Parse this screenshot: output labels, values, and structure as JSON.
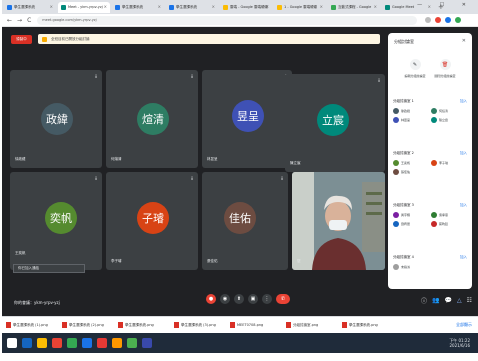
{
  "browser": {
    "tabs": [
      {
        "label": "學生選課系統",
        "color": "#1a73e8",
        "active": false
      },
      {
        "label": "Meet - ykm-yrpv-yzj",
        "color": "#00897b",
        "active": true
      },
      {
        "label": "學生選課系統",
        "color": "#1a73e8",
        "active": false
      },
      {
        "label": "學生選課系統",
        "color": "#1a73e8",
        "active": false
      },
      {
        "label": "雲端 - Google 雲端硬碟",
        "color": "#fbbc04",
        "active": false
      },
      {
        "label": "1 - Google 雲端硬碟",
        "color": "#fbbc04",
        "active": false
      },
      {
        "label": "互動式課程 - Google",
        "color": "#34a853",
        "active": false
      },
      {
        "label": "Google Meet",
        "color": "#00897b",
        "active": false
      }
    ],
    "new_tab": "+",
    "window_controls": "— ☐ ✕",
    "url": "meet.google.com/ykm-yrpv-yzj",
    "back": "←",
    "forward": "→",
    "reload": "C"
  },
  "meet": {
    "rec_label": "錄製中",
    "notice": "全班目前已開放分組討論",
    "tiles": [
      {
        "name": "政緯",
        "label": "徐政緯",
        "color": "#455a64"
      },
      {
        "name": "煊清",
        "label": "何煊清",
        "color": "#2e7d63"
      },
      {
        "name": "昱呈",
        "label": "林昱呈",
        "color": "#3f51b5"
      },
      {
        "name": "立宸",
        "label": "陳立宸",
        "color": "#00897b"
      },
      {
        "name": "奕帆",
        "label": "王奕帆",
        "color": "#558b2f"
      },
      {
        "name": "子璿",
        "label": "李子璿",
        "color": "#d84315"
      },
      {
        "name": "佳佑",
        "label": "張佳佑",
        "color": "#6d4c41"
      },
      {
        "name": "",
        "label": "您",
        "color": ""
      }
    ],
    "caption": "你已加入通話",
    "meeting_code": "你的會議：ykm-yrpv-yzj",
    "controls": [
      "●",
      "◉",
      "⬆",
      "▣",
      "⋮",
      "✆"
    ],
    "right_icons": [
      "ⓘ",
      "👥",
      "💬",
      "△",
      "☷"
    ]
  },
  "panel": {
    "title": "分組討論室",
    "close": "✕",
    "actions": [
      {
        "icon": "✎",
        "label": "編輯分組討論室"
      },
      {
        "icon": "🗑",
        "label": "關閉分組討論室"
      }
    ],
    "groups": [
      {
        "title": "分組討論室 1",
        "link": "加入",
        "members": [
          {
            "n": "徐政緯",
            "c": "#455a64"
          },
          {
            "n": "何煊清",
            "c": "#2e7d63"
          },
          {
            "n": "林昱呈",
            "c": "#3f51b5"
          },
          {
            "n": "陳立宸",
            "c": "#00897b"
          }
        ]
      },
      {
        "title": "分組討論室 2",
        "link": "加入",
        "members": [
          {
            "n": "王奕帆",
            "c": "#558b2f"
          },
          {
            "n": "李子璿",
            "c": "#d84315"
          },
          {
            "n": "張佳佑",
            "c": "#6d4c41"
          }
        ]
      },
      {
        "title": "分組討論室 3",
        "link": "加入",
        "members": [
          {
            "n": "黃宇翔",
            "c": "#7b1fa2"
          },
          {
            "n": "吳承恩",
            "c": "#2e7d32"
          },
          {
            "n": "劉宥辰",
            "c": "#1565c0"
          },
          {
            "n": "蔡昀廷",
            "c": "#c62828"
          }
        ]
      },
      {
        "title": "分組討論室 4",
        "link": "加入",
        "members": [
          {
            "n": "未指派",
            "c": "#9e9e9e"
          }
        ]
      }
    ]
  },
  "downloads": {
    "items": [
      "學生選課系統 (1).png",
      "學生選課系統 (2).png",
      "學生選課系統.png",
      "學生選課系統 (3).png",
      "MEET0708.png",
      "分組討論室.png",
      "學生選課系統.png"
    ],
    "show_all": "全部顯示"
  },
  "taskbar": {
    "apps": [
      "#ffffff",
      "#1565c0",
      "#fbbc04",
      "#ea4335",
      "#34a853",
      "#1a73e8",
      "#e53935",
      "#ff9800",
      "#4caf50",
      "#3949ab"
    ],
    "time": "下午 01:22",
    "date": "2021/6/16"
  }
}
